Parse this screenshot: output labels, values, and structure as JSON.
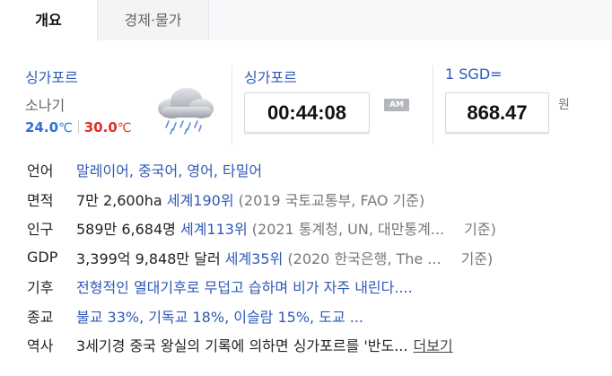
{
  "tabs": [
    {
      "label": "개요"
    },
    {
      "label": "경제·물가"
    }
  ],
  "weather": {
    "city": "싱가포르",
    "condition": "소나기",
    "low": "24.0",
    "high": "30.0",
    "unit": "℃",
    "icon": "rain-cloud-icon"
  },
  "time": {
    "city": "싱가포르",
    "clock": "00:44:08",
    "ampm": "AM"
  },
  "exchange": {
    "label": "1 SGD=",
    "value": "868.47",
    "unit": "원"
  },
  "info": {
    "language": {
      "label": "언어",
      "value": "말레이어, 중국어, 영어, 타밀어"
    },
    "area": {
      "label": "면적",
      "value": "7만 2,600ha",
      "rank": "세계190위",
      "source": "(2019 국토교통부, FAO 기준)"
    },
    "population": {
      "label": "인구",
      "value": "589만 6,684명",
      "rank": "세계113위",
      "source": "(2021 통계청, UN, 대만통계...",
      "source_end": "기준)"
    },
    "gdp": {
      "label": "GDP",
      "value": "3,399억 9,848만 달러",
      "rank": "세계35위",
      "source": "(2020 한국은행, The ...",
      "source_end": "기준)"
    },
    "climate": {
      "label": "기후",
      "value": "전형적인 열대기후로 무덥고 습하며 비가 자주 내린다...."
    },
    "religion": {
      "label": "종교",
      "value": "불교 33%, 기독교 18%, 이슬람 15%, 도교 ..."
    },
    "history": {
      "label": "역사",
      "value": "3세기경 중국 왕실의 기록에 의하면 싱가포르를 '반도...",
      "more": "더보기"
    }
  }
}
